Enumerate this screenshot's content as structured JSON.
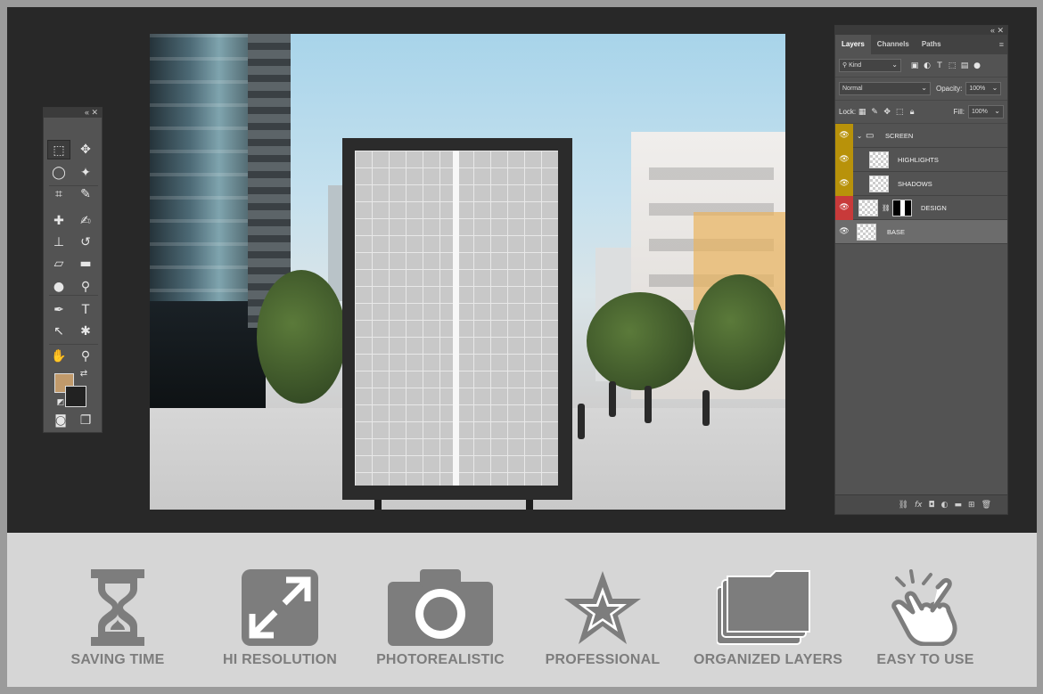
{
  "tools_panel": {
    "header_controls": "«  ✕",
    "tools": [
      {
        "name": "marquee-tool",
        "glyph": "⬚",
        "active": true
      },
      {
        "name": "move-tool",
        "glyph": "✥"
      },
      {
        "name": "lasso-tool",
        "glyph": "◯"
      },
      {
        "name": "magic-wand-tool",
        "glyph": "✦"
      },
      {
        "name": "crop-tool",
        "glyph": "⌗"
      },
      {
        "name": "eyedropper-tool",
        "glyph": "✎"
      },
      {
        "name": "healing-brush-tool",
        "glyph": "✚"
      },
      {
        "name": "brush-tool",
        "glyph": "✍"
      },
      {
        "name": "stamp-tool",
        "glyph": "⊥"
      },
      {
        "name": "history-brush-tool",
        "glyph": "↺"
      },
      {
        "name": "eraser-tool",
        "glyph": "▱"
      },
      {
        "name": "gradient-tool",
        "glyph": "▬"
      },
      {
        "name": "blur-tool",
        "glyph": "●"
      },
      {
        "name": "dodge-tool",
        "glyph": "⚲"
      },
      {
        "name": "pen-tool",
        "glyph": "✒"
      },
      {
        "name": "type-tool",
        "glyph": "T"
      },
      {
        "name": "path-selection-tool",
        "glyph": "↖"
      },
      {
        "name": "shape-tool",
        "glyph": "✱"
      },
      {
        "name": "hand-tool",
        "glyph": "✋"
      },
      {
        "name": "zoom-tool",
        "glyph": "⚲"
      }
    ],
    "foreground_color": "#c19a6b",
    "background_color": "#222222"
  },
  "layers_panel": {
    "header_controls": "«  ✕",
    "tabs": [
      "Layers",
      "Channels",
      "Paths"
    ],
    "active_tab": "Layers",
    "filter_kind": "Kind",
    "blend_mode": "Normal",
    "opacity_label": "Opacity:",
    "opacity_value": "100%",
    "lock_label": "Lock:",
    "fill_label": "Fill:",
    "fill_value": "100%",
    "layers": [
      {
        "name": "SCREEN",
        "type": "group",
        "eye_color": "#b8920a"
      },
      {
        "name": "HIGHLIGHTS",
        "type": "layer",
        "eye_color": "#b8920a"
      },
      {
        "name": "SHADOWS",
        "type": "layer",
        "eye_color": "#b8920a"
      },
      {
        "name": "DESIGN",
        "type": "smart-object",
        "eye_color": "#c83a3a"
      },
      {
        "name": "BASE",
        "type": "layer",
        "selected": true
      }
    ]
  },
  "features": [
    {
      "label": "SAVING TIME",
      "icon": "hourglass-icon"
    },
    {
      "label": "HI RESOLUTION",
      "icon": "expand-arrows-icon"
    },
    {
      "label": "PHOTOREALISTIC",
      "icon": "camera-icon"
    },
    {
      "label": "PROFESSIONAL",
      "icon": "star-icon"
    },
    {
      "label": "ORGANIZED LAYERS",
      "icon": "folders-icon"
    },
    {
      "label": "EASY TO USE",
      "icon": "tap-hand-icon"
    }
  ],
  "colors": {
    "workspace": "#282828",
    "panel": "#535353",
    "feature_icon": "#7d7d7d",
    "feature_strip": "#d6d6d6"
  }
}
